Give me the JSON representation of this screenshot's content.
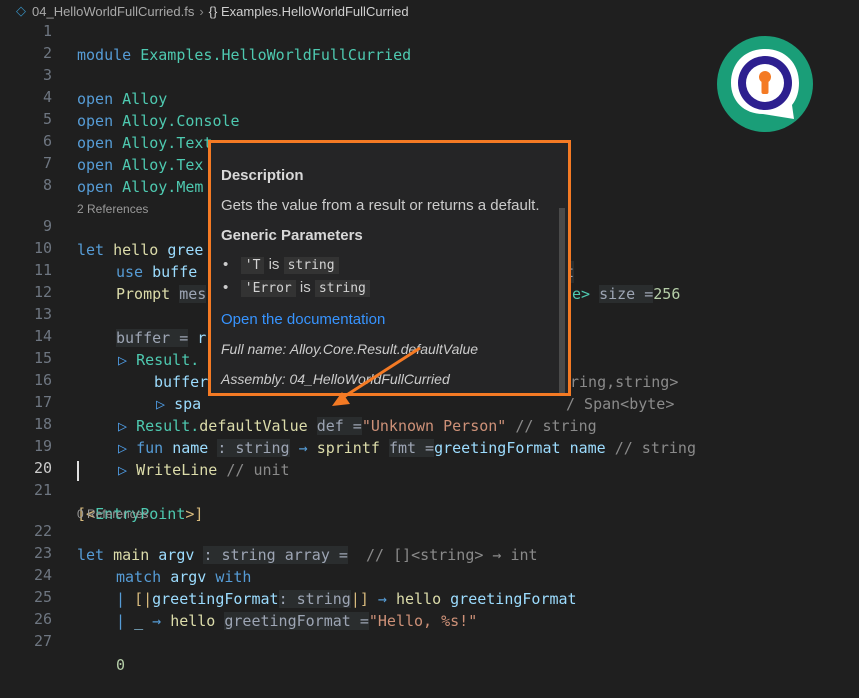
{
  "breadcrumb": {
    "file": "04_HelloWorldFullCurried.fs",
    "symbol": "{} Examples.HelloWorldFullCurried"
  },
  "lens": {
    "line9": "2 References",
    "line22": "0 References"
  },
  "lines": {
    "l1": {
      "kw": "module",
      "name": "Examples.HelloWorldFullCurried"
    },
    "l3": {
      "kw": "open",
      "name": "Alloy"
    },
    "l4": {
      "kw": "open",
      "ns": "Alloy.",
      "name": "Console"
    },
    "l5": {
      "kw": "open",
      "ns": "Alloy.",
      "name": "Text"
    },
    "l6": {
      "kw": "open",
      "ns": "Alloy.",
      "name": "Tex"
    },
    "l7": {
      "kw": "open",
      "ns": "Alloy.",
      "name": "Mem"
    },
    "l9": {
      "kw": "let",
      "fn": "hello",
      "partial": "gree",
      "tail": "t"
    },
    "l10": {
      "kw": "use",
      "va": "buffe",
      "ty": "e>",
      "hint": "size =",
      "num": "256"
    },
    "l11": {
      "fn": "Prompt",
      "hint": "mes"
    },
    "l13": {
      "hint": "buffer =",
      "va": "r"
    },
    "l14": {
      "ty": "Result.",
      "tail": "ring,string>"
    },
    "l15": {
      "va": "buffer",
      "tail": "/ Span<byte>"
    },
    "l16": {
      "va": "spa"
    },
    "l17": {
      "ty": "Result.",
      "fn": "defaultValue",
      "hint": "def =",
      "str": "\"Unknown Person\"",
      "cm": "// string"
    },
    "l18": {
      "kw": "fun",
      "va": "name",
      "hint": ": string",
      "arrow": "→",
      "fn": "sprintf",
      "hint2": "fmt =",
      "va2": "greetingFormat",
      "va3": "name",
      "cm": "// string"
    },
    "l19": {
      "fn": "WriteLine",
      "cm": "// unit"
    },
    "l21": {
      "open": "[<",
      "attr": "EntryPoint",
      "close": ">]"
    },
    "l22": {
      "kw": "let",
      "fn": "main",
      "va": "argv",
      "hint": ": string array =",
      "cm": "// []<string> → int"
    },
    "l23": {
      "kw": "match",
      "va": "argv",
      "kw2": "with"
    },
    "l24": {
      "bar": "|",
      "open": "[|",
      "va": "greetingFormat",
      "hint": ": string",
      "close": "|]",
      "arrow": "→",
      "fn": "hello",
      "va2": "greetingFormat"
    },
    "l25": {
      "bar": "|",
      "us": "_",
      "arrow": "→",
      "fn": "hello",
      "hint": "greetingFormat =",
      "str": "\"Hello, %s!\""
    },
    "l27": {
      "num": "0"
    }
  },
  "line_numbers": [
    "1",
    "2",
    "3",
    "4",
    "5",
    "6",
    "7",
    "8",
    "9",
    "10",
    "11",
    "12",
    "13",
    "14",
    "15",
    "16",
    "17",
    "18",
    "19",
    "20",
    "21",
    "22",
    "23",
    "24",
    "25",
    "26",
    "27"
  ],
  "tooltip": {
    "description_heading": "Description",
    "description_text": "Gets the value from a result or returns a default.",
    "generic_heading": "Generic Parameters",
    "param1_name": "'T",
    "param1_is": "is",
    "param1_type": "string",
    "param2_name": "'Error",
    "param2_is": "is",
    "param2_type": "string",
    "doc_link": "Open the documentation",
    "full_name": "Full name: Alloy.Core.Result.defaultValue",
    "assembly": "Assembly: 04_HelloWorldFullCurried"
  },
  "colors": {
    "annotation": "#f47a24",
    "logo_teal": "#1a9e78",
    "logo_purple": "#2d1f8f"
  }
}
